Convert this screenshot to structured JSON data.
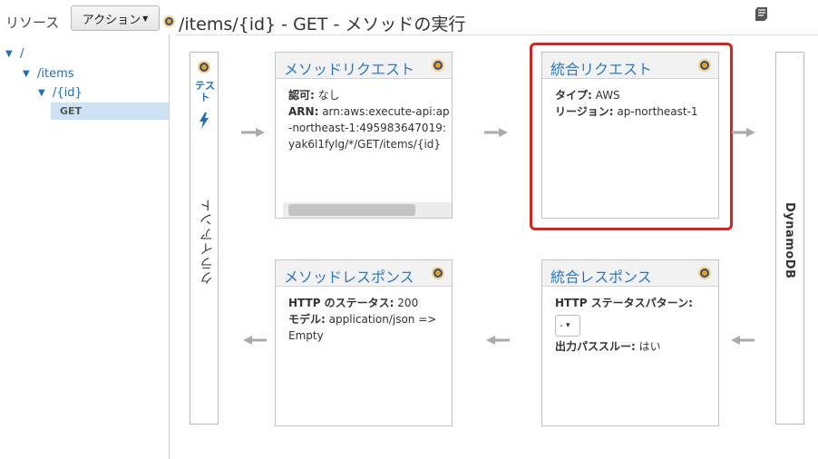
{
  "left_panel": {
    "title": "リソース",
    "action_button": "アクション",
    "tree": [
      {
        "label": "/",
        "depth": 0
      },
      {
        "label": "/items",
        "depth": 1
      },
      {
        "label": "/{id}",
        "depth": 2
      }
    ],
    "selected_method": "GET"
  },
  "header": {
    "title": "/items/{id} - GET - メソッドの実行"
  },
  "client": {
    "test_link": "テスト",
    "label": "クライアント"
  },
  "backend": {
    "label": "DynamoDB"
  },
  "method_request": {
    "title": "メソッドリクエスト",
    "auth_label": "認可:",
    "auth_value": "なし",
    "arn_label": "ARN:",
    "arn_value": "arn:aws:execute-api:ap-northeast-1:495983647019:yak6l1fylg/*/GET/items/{id}"
  },
  "integration_request": {
    "title": "統合リクエスト",
    "type_label": "タイプ:",
    "type_value": "AWS",
    "region_label": "リージョン:",
    "region_value": "ap-northeast-1"
  },
  "method_response": {
    "title": "メソッドレスポンス",
    "status_label": "HTTP のステータス:",
    "status_value": "200",
    "model_label": "モデル:",
    "model_value": "application/json => Empty"
  },
  "integration_response": {
    "title": "統合レスポンス",
    "pattern_label": "HTTP ステータスパターン:",
    "pattern_select_value": "-",
    "passthrough_label": "出力パススルー:",
    "passthrough_value": "はい"
  },
  "colors": {
    "link_blue": "#2c79c4",
    "highlight_red": "#d6231c",
    "status_dot_orange": "#f39c12",
    "arrow_gray": "#aaaaaa"
  },
  "icons": [
    "doc-icon",
    "status-dot-icon",
    "lightning-icon",
    "arrow-right-icon",
    "arrow-left-icon",
    "triangle-down-icon",
    "chevron-down-icon"
  ]
}
